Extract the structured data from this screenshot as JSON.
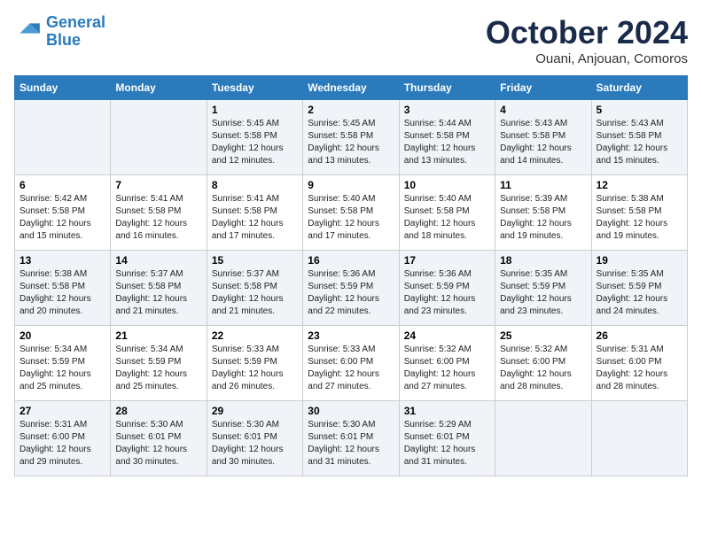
{
  "logo": {
    "line1": "General",
    "line2": "Blue"
  },
  "title": "October 2024",
  "subtitle": "Ouani, Anjouan, Comoros",
  "days_header": [
    "Sunday",
    "Monday",
    "Tuesday",
    "Wednesday",
    "Thursday",
    "Friday",
    "Saturday"
  ],
  "weeks": [
    [
      {
        "day": "",
        "info": ""
      },
      {
        "day": "",
        "info": ""
      },
      {
        "day": "1",
        "info": "Sunrise: 5:45 AM\nSunset: 5:58 PM\nDaylight: 12 hours\nand 12 minutes."
      },
      {
        "day": "2",
        "info": "Sunrise: 5:45 AM\nSunset: 5:58 PM\nDaylight: 12 hours\nand 13 minutes."
      },
      {
        "day": "3",
        "info": "Sunrise: 5:44 AM\nSunset: 5:58 PM\nDaylight: 12 hours\nand 13 minutes."
      },
      {
        "day": "4",
        "info": "Sunrise: 5:43 AM\nSunset: 5:58 PM\nDaylight: 12 hours\nand 14 minutes."
      },
      {
        "day": "5",
        "info": "Sunrise: 5:43 AM\nSunset: 5:58 PM\nDaylight: 12 hours\nand 15 minutes."
      }
    ],
    [
      {
        "day": "6",
        "info": "Sunrise: 5:42 AM\nSunset: 5:58 PM\nDaylight: 12 hours\nand 15 minutes."
      },
      {
        "day": "7",
        "info": "Sunrise: 5:41 AM\nSunset: 5:58 PM\nDaylight: 12 hours\nand 16 minutes."
      },
      {
        "day": "8",
        "info": "Sunrise: 5:41 AM\nSunset: 5:58 PM\nDaylight: 12 hours\nand 17 minutes."
      },
      {
        "day": "9",
        "info": "Sunrise: 5:40 AM\nSunset: 5:58 PM\nDaylight: 12 hours\nand 17 minutes."
      },
      {
        "day": "10",
        "info": "Sunrise: 5:40 AM\nSunset: 5:58 PM\nDaylight: 12 hours\nand 18 minutes."
      },
      {
        "day": "11",
        "info": "Sunrise: 5:39 AM\nSunset: 5:58 PM\nDaylight: 12 hours\nand 19 minutes."
      },
      {
        "day": "12",
        "info": "Sunrise: 5:38 AM\nSunset: 5:58 PM\nDaylight: 12 hours\nand 19 minutes."
      }
    ],
    [
      {
        "day": "13",
        "info": "Sunrise: 5:38 AM\nSunset: 5:58 PM\nDaylight: 12 hours\nand 20 minutes."
      },
      {
        "day": "14",
        "info": "Sunrise: 5:37 AM\nSunset: 5:58 PM\nDaylight: 12 hours\nand 21 minutes."
      },
      {
        "day": "15",
        "info": "Sunrise: 5:37 AM\nSunset: 5:58 PM\nDaylight: 12 hours\nand 21 minutes."
      },
      {
        "day": "16",
        "info": "Sunrise: 5:36 AM\nSunset: 5:59 PM\nDaylight: 12 hours\nand 22 minutes."
      },
      {
        "day": "17",
        "info": "Sunrise: 5:36 AM\nSunset: 5:59 PM\nDaylight: 12 hours\nand 23 minutes."
      },
      {
        "day": "18",
        "info": "Sunrise: 5:35 AM\nSunset: 5:59 PM\nDaylight: 12 hours\nand 23 minutes."
      },
      {
        "day": "19",
        "info": "Sunrise: 5:35 AM\nSunset: 5:59 PM\nDaylight: 12 hours\nand 24 minutes."
      }
    ],
    [
      {
        "day": "20",
        "info": "Sunrise: 5:34 AM\nSunset: 5:59 PM\nDaylight: 12 hours\nand 25 minutes."
      },
      {
        "day": "21",
        "info": "Sunrise: 5:34 AM\nSunset: 5:59 PM\nDaylight: 12 hours\nand 25 minutes."
      },
      {
        "day": "22",
        "info": "Sunrise: 5:33 AM\nSunset: 5:59 PM\nDaylight: 12 hours\nand 26 minutes."
      },
      {
        "day": "23",
        "info": "Sunrise: 5:33 AM\nSunset: 6:00 PM\nDaylight: 12 hours\nand 27 minutes."
      },
      {
        "day": "24",
        "info": "Sunrise: 5:32 AM\nSunset: 6:00 PM\nDaylight: 12 hours\nand 27 minutes."
      },
      {
        "day": "25",
        "info": "Sunrise: 5:32 AM\nSunset: 6:00 PM\nDaylight: 12 hours\nand 28 minutes."
      },
      {
        "day": "26",
        "info": "Sunrise: 5:31 AM\nSunset: 6:00 PM\nDaylight: 12 hours\nand 28 minutes."
      }
    ],
    [
      {
        "day": "27",
        "info": "Sunrise: 5:31 AM\nSunset: 6:00 PM\nDaylight: 12 hours\nand 29 minutes."
      },
      {
        "day": "28",
        "info": "Sunrise: 5:30 AM\nSunset: 6:01 PM\nDaylight: 12 hours\nand 30 minutes."
      },
      {
        "day": "29",
        "info": "Sunrise: 5:30 AM\nSunset: 6:01 PM\nDaylight: 12 hours\nand 30 minutes."
      },
      {
        "day": "30",
        "info": "Sunrise: 5:30 AM\nSunset: 6:01 PM\nDaylight: 12 hours\nand 31 minutes."
      },
      {
        "day": "31",
        "info": "Sunrise: 5:29 AM\nSunset: 6:01 PM\nDaylight: 12 hours\nand 31 minutes."
      },
      {
        "day": "",
        "info": ""
      },
      {
        "day": "",
        "info": ""
      }
    ]
  ]
}
